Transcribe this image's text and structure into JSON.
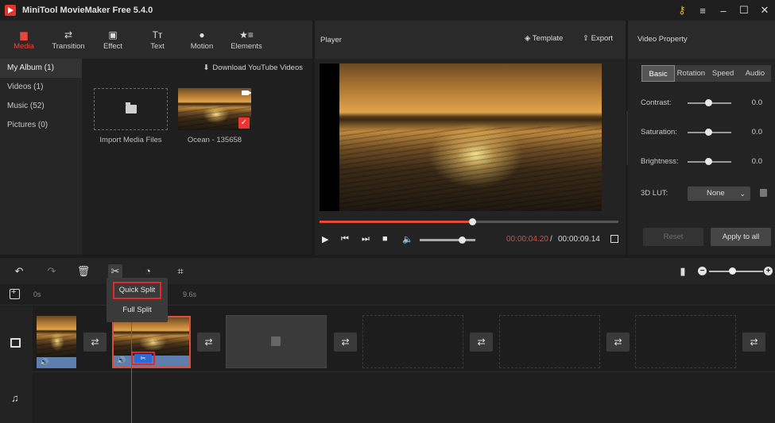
{
  "window": {
    "title": "MiniTool MovieMaker Free 5.4.0",
    "controls": [
      "key-icon",
      "menu-icon",
      "minimize-icon",
      "maximize-icon",
      "close-icon"
    ]
  },
  "tool_tabs": [
    {
      "label": "Media",
      "icon": "media-folder-icon",
      "active": true
    },
    {
      "label": "Transition",
      "icon": "transition-icon"
    },
    {
      "label": "Effect",
      "icon": "effect-icon"
    },
    {
      "label": "Text",
      "icon": "text-icon"
    },
    {
      "label": "Motion",
      "icon": "motion-icon"
    },
    {
      "label": "Elements",
      "icon": "elements-icon"
    }
  ],
  "albums": [
    {
      "label": "My Album (1)",
      "active": true
    },
    {
      "label": "Videos (1)"
    },
    {
      "label": "Music (52)"
    },
    {
      "label": "Pictures (0)"
    }
  ],
  "media": {
    "download_label": "Download YouTube Videos",
    "import_label": "Import Media Files",
    "clip_label": "Ocean - 135658"
  },
  "player": {
    "title": "Player",
    "template_label": "Template",
    "export_label": "Export",
    "progress": 0.51,
    "volume": 0.75,
    "current_time": "00:00:04.20",
    "separator": "/",
    "duration": "00:00:09.14"
  },
  "property": {
    "title": "Video Property",
    "tabs": [
      "Basic",
      "Rotation",
      "Speed",
      "Audio"
    ],
    "active_tab": "Basic",
    "contrast_label": "Contrast:",
    "contrast_value": "0.0",
    "saturation_label": "Saturation:",
    "saturation_value": "0.0",
    "brightness_label": "Brightness:",
    "brightness_value": "0.0",
    "lut_label": "3D LUT:",
    "lut_value": "None",
    "reset_label": "Reset",
    "apply_label": "Apply to all"
  },
  "timeline": {
    "tools": [
      "undo-icon",
      "redo-icon",
      "delete-icon",
      "split-icon",
      "speed-icon",
      "crop-icon"
    ],
    "ruler": [
      "0s",
      "9.6s"
    ],
    "split_menu": {
      "quick": "Quick Split",
      "full": "Full Split"
    },
    "zoom_minus": "−",
    "zoom_plus": "+",
    "zoom_level": 0.42
  },
  "colors": {
    "accent": "#e8463b",
    "highlight_box": "#e02a2a",
    "playhead": "#2d6cd8"
  }
}
